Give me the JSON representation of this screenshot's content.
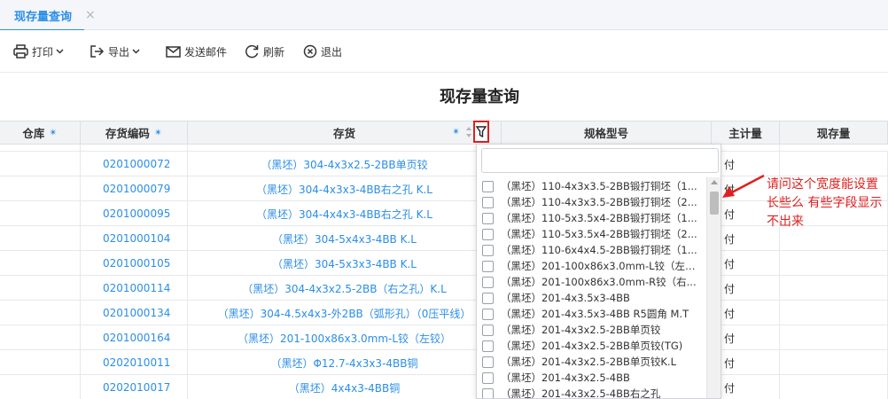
{
  "tab": {
    "title": "现存量查询",
    "close": "×"
  },
  "toolbar": {
    "print": "打印",
    "export": "导出",
    "email": "发送邮件",
    "refresh": "刷新",
    "exit": "退出"
  },
  "report_title": "现存量查询",
  "columns": {
    "warehouse": "仓库",
    "code": "存货编码",
    "item": "存货",
    "spec": "规格型号",
    "unit": "主计量",
    "qty": "现存量"
  },
  "rows": [
    {
      "code": "0201000072",
      "name": "（黑坯）304-4x3x2.5-2BB单页铰",
      "unit": "付"
    },
    {
      "code": "0201000079",
      "name": "（黑坯）304-4x3x3-4BB右之孔 K.L",
      "unit": "付"
    },
    {
      "code": "0201000095",
      "name": "（黑坯）304-4x4x3-4BB右之孔 K.L",
      "unit": "付"
    },
    {
      "code": "0201000104",
      "name": "（黑坯）304-5x4x3-4BB K.L",
      "unit": "付"
    },
    {
      "code": "0201000105",
      "name": "（黑坯）304-5x3x3-4BB K.L",
      "unit": "付"
    },
    {
      "code": "0201000114",
      "name": "（黑坯）304-4x3x2.5-2BB（右之孔）K.L",
      "unit": "付"
    },
    {
      "code": "0201000134",
      "name": "（黑坯）304-4.5x4x3-外2BB（弧形孔）（0压平线）",
      "unit": "付"
    },
    {
      "code": "0201000164",
      "name": "（黑坯）201-100x86x3.0mm-L铰（左铰）",
      "unit": "付"
    },
    {
      "code": "0202010011",
      "name": "（黑坯）Φ12.7-4x3x3-4BB铜",
      "unit": "付"
    },
    {
      "code": "0202010017",
      "name": "（黑坯）4x4x3-4BB铜",
      "unit": "付"
    }
  ],
  "filter_dropdown": {
    "search_value": "",
    "options": [
      "（黑坯）110-4x3x3.5-2BB锻打铜坯（1...",
      "（黑坯）110-4x3x3.5-2BB锻打铜坯（2...",
      "（黑坯）110-5x3.5x4-2BB锻打铜坯（1...",
      "（黑坯）110-5x3.5x4-2BB锻打铜坯（2...",
      "（黑坯）110-6x4x4.5-2BB锻打铜坯（1...",
      "（黑坯）201-100x86x3.0mm-L铰（左铰...",
      "（黑坯）201-100x86x3.0mm-R铰（右...",
      "（黑坯）201-4x3.5x3-4BB",
      "（黑坯）201-4x3.5x3-4BB R5圆角 M.T",
      "（黑坯）201-4x3x2.5-2BB单页铰",
      "（黑坯）201-4x3x2.5-2BB单页铰(TG)",
      "（黑坯）201-4x3x2.5-2BB单页铰K.L",
      "（黑坯）201-4x3x2.5-4BB",
      "（黑坯）201-4x3x2.5-4BB右之孔"
    ]
  },
  "annotation": "请问这个宽度能设置长些么  有些字段显示不出来",
  "colors": {
    "accent": "#2a8ee9",
    "annotation": "#e02020"
  }
}
